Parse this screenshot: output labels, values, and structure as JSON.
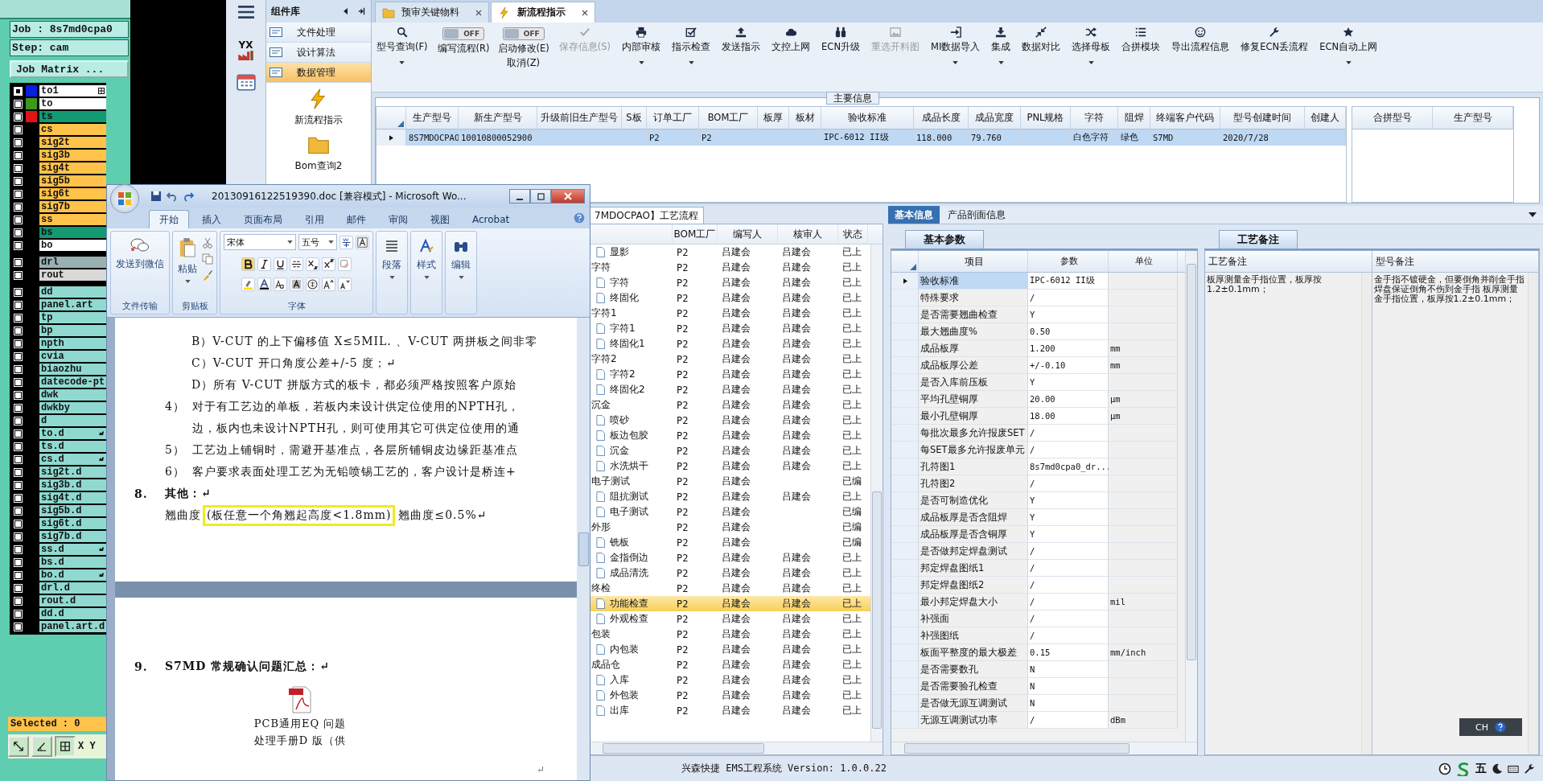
{
  "job_matrix": {
    "job": "Job : 8s7md0cpa0",
    "step": "Step: cam",
    "matrix_button": "Job Matrix ...",
    "layer_groups": [
      [
        {
          "name": "to1",
          "color": "#ffffff",
          "swatch": {
            "color": "#0a1ee0"
          },
          "checked": true,
          "kind": "grid"
        },
        {
          "name": "to",
          "color": "#ffffff",
          "swatch": {
            "color": "#3a9a1e"
          },
          "checked": false,
          "kind": "plain"
        },
        {
          "name": "ts",
          "color": "#129a72",
          "swatch": {
            "color": "#e01414"
          },
          "checked": false,
          "kind": "plain"
        },
        {
          "name": "cs",
          "color": "#ffc24a",
          "checked": false,
          "kind": "plain"
        },
        {
          "name": "sig2t",
          "color": "#ffc24a",
          "checked": false,
          "kind": "plain"
        },
        {
          "name": "sig3b",
          "color": "#ffc24a",
          "checked": false,
          "kind": "plain"
        },
        {
          "name": "sig4t",
          "color": "#ffc24a",
          "checked": false,
          "kind": "plain"
        },
        {
          "name": "sig5b",
          "color": "#ffc24a",
          "checked": false,
          "kind": "plain"
        },
        {
          "name": "sig6t",
          "color": "#ffc24a",
          "checked": false,
          "kind": "plain"
        },
        {
          "name": "sig7b",
          "color": "#ffc24a",
          "checked": false,
          "kind": "plain"
        },
        {
          "name": "ss",
          "color": "#ffc24a",
          "checked": false,
          "kind": "plain"
        },
        {
          "name": "bs",
          "color": "#129a72",
          "checked": false,
          "kind": "plain"
        },
        {
          "name": "bo",
          "color": "#ffffff",
          "checked": false,
          "kind": "plain"
        }
      ],
      [
        {
          "name": "drl",
          "color": "#9ab0b0",
          "checked": false,
          "kind": "plain"
        },
        {
          "name": "rout",
          "color": "#d8d8d8",
          "checked": false,
          "kind": "plain"
        }
      ],
      [
        {
          "name": "dd",
          "color": "#8fd9d0",
          "checked": false,
          "kind": "plain"
        },
        {
          "name": "panel.art",
          "color": "#8fd9d0",
          "checked": false,
          "kind": "plain"
        },
        {
          "name": "tp",
          "color": "#8fd9d0",
          "checked": false,
          "kind": "plain"
        },
        {
          "name": "bp",
          "color": "#8fd9d0",
          "checked": false,
          "kind": "plain"
        },
        {
          "name": "npth",
          "color": "#8fd9d0",
          "checked": false,
          "kind": "plain"
        },
        {
          "name": "cvia",
          "color": "#8fd9d0",
          "checked": false,
          "kind": "plain"
        },
        {
          "name": "biaozhu",
          "color": "#8fd9d0",
          "checked": false,
          "kind": "plain"
        },
        {
          "name": "datecode-pt",
          "color": "#8fd9d0",
          "checked": false,
          "kind": "plain"
        },
        {
          "name": "dwk",
          "color": "#8fd9d0",
          "checked": false,
          "kind": "plain"
        },
        {
          "name": "dwkby",
          "color": "#8fd9d0",
          "checked": false,
          "kind": "plain"
        },
        {
          "name": "d",
          "color": "#8fd9d0",
          "checked": false,
          "kind": "plain"
        },
        {
          "name": "to.d",
          "color": "#8fd9d0",
          "checked": false,
          "kind": "hand"
        },
        {
          "name": "ts.d",
          "color": "#8fd9d0",
          "checked": false,
          "kind": "plain"
        },
        {
          "name": "cs.d",
          "color": "#8fd9d0",
          "checked": false,
          "kind": "hand"
        },
        {
          "name": "sig2t.d",
          "color": "#8fd9d0",
          "checked": false,
          "kind": "plain"
        },
        {
          "name": "sig3b.d",
          "color": "#8fd9d0",
          "checked": false,
          "kind": "plain"
        },
        {
          "name": "sig4t.d",
          "color": "#8fd9d0",
          "checked": false,
          "kind": "plain"
        },
        {
          "name": "sig5b.d",
          "color": "#8fd9d0",
          "checked": false,
          "kind": "plain"
        },
        {
          "name": "sig6t.d",
          "color": "#8fd9d0",
          "checked": false,
          "kind": "plain"
        },
        {
          "name": "sig7b.d",
          "color": "#8fd9d0",
          "checked": false,
          "kind": "plain"
        },
        {
          "name": "ss.d",
          "color": "#8fd9d0",
          "checked": false,
          "kind": "hand"
        },
        {
          "name": "bs.d",
          "color": "#8fd9d0",
          "checked": false,
          "kind": "plain"
        },
        {
          "name": "bo.d",
          "color": "#8fd9d0",
          "checked": false,
          "kind": "hand"
        },
        {
          "name": "drl.d",
          "color": "#8fd9d0",
          "checked": false,
          "kind": "plain"
        },
        {
          "name": "rout.d",
          "color": "#8fd9d0",
          "checked": false,
          "kind": "plain"
        },
        {
          "name": "dd.d",
          "color": "#8fd9d0",
          "checked": false,
          "kind": "plain"
        },
        {
          "name": "panel.art.d",
          "color": "#8fd9d0",
          "checked": false,
          "kind": "plain"
        }
      ]
    ],
    "selected_count": "Selected : 0",
    "coordinate_label": "X Y"
  },
  "app": {
    "strip_icons": [
      {
        "kind": "factory",
        "text": "YX"
      },
      {
        "kind": "calendar"
      }
    ],
    "component_library": {
      "title": "组件库",
      "items": [
        {
          "label": "文件处理",
          "selected": false
        },
        {
          "label": "设计算法",
          "selected": false
        },
        {
          "label": "数据管理",
          "selected": true
        }
      ],
      "tools": [
        "新流程指示",
        "Bom查询2"
      ]
    },
    "tabs": [
      {
        "label": "预审关键物料",
        "selected": false
      },
      {
        "label": "新流程指示",
        "selected": true
      }
    ],
    "toolbar": [
      {
        "kind": "button",
        "label": "型号查询(F)",
        "menu": true,
        "disabled": false
      },
      {
        "kind": "toggle",
        "label": "编写流程(R)",
        "state": "OFF",
        "on": false
      },
      {
        "kind": "toggle",
        "label": "启动修改(E)",
        "sublabel": "取消(Z)",
        "state": "OFF",
        "on": false
      },
      {
        "kind": "button",
        "label": "保存信息(S)",
        "menu": false,
        "disabled": true
      },
      {
        "kind": "button",
        "label": "内部审核",
        "menu": true,
        "disabled": false
      },
      {
        "kind": "button",
        "label": "指示检查",
        "menu": true,
        "disabled": false
      },
      {
        "kind": "button",
        "label": "发送指示",
        "menu": false,
        "disabled": false
      },
      {
        "kind": "button",
        "label": "文控上网",
        "menu": false,
        "disabled": false
      },
      {
        "kind": "button",
        "label": "ECN升级",
        "menu": false,
        "disabled": false
      },
      {
        "kind": "button",
        "label": "重选开料图",
        "menu": false,
        "disabled": true
      },
      {
        "kind": "button",
        "label": "MI数据导入",
        "menu": true,
        "disabled": false
      },
      {
        "kind": "button",
        "label": "集成",
        "menu": true,
        "disabled": false
      },
      {
        "kind": "button",
        "label": "数据对比",
        "menu": false,
        "disabled": false
      },
      {
        "kind": "button",
        "label": "选择母板",
        "menu": true,
        "disabled": false
      },
      {
        "kind": "button",
        "label": "合拼模块",
        "menu": false,
        "disabled": false
      },
      {
        "kind": "button",
        "label": "导出流程信息",
        "menu": false,
        "disabled": false
      },
      {
        "kind": "button",
        "label": "修复ECN丢流程",
        "menu": false,
        "disabled": false
      },
      {
        "kind": "button",
        "label": "ECN自动上网",
        "menu": true,
        "disabled": false
      }
    ],
    "main_info": {
      "title": "主要信息",
      "columns": [
        "生产型号",
        "新生产型号",
        "升级前旧生产型号",
        "S板",
        "订单工厂",
        "BOM工厂",
        "板厚",
        "板材",
        "验收标准",
        "成品长度",
        "成品宽度",
        "PNL规格",
        "字符",
        "阻焊",
        "终端客户代码",
        "型号创建时间",
        "创建人"
      ],
      "rows": [
        {
          "selected": true,
          "cells": [
            "8S7MDOCPAO",
            "10010800052900",
            "",
            "",
            "P2",
            "P2",
            "",
            "",
            "IPC-6012 II级",
            "118.000",
            "79.760",
            "",
            "白色字符",
            "绿色",
            "S7MD",
            "2020/7/28",
            ""
          ]
        }
      ],
      "merge_columns": [
        "合拼型号",
        "生产型号"
      ]
    },
    "process_flow": {
      "tab": "7MDOCPAO】工艺流程",
      "columns": [
        "BOM工厂",
        "编写人",
        "核审人",
        "状态"
      ],
      "rows": [
        {
          "children": [
            {
              "label": "显影",
              "bom": "P2",
              "writer": "吕建会",
              "reviewer": "吕建会",
              "status": "已上",
              "selected": false
            }
          ]
        },
        {
          "label": "字符",
          "bom": "P2",
          "writer": "吕建会",
          "reviewer": "吕建会",
          "status": "已上",
          "selected": false,
          "children": [
            {
              "label": "字符",
              "bom": "P2",
              "writer": "吕建会",
              "reviewer": "吕建会",
              "status": "已上",
              "selected": false
            },
            {
              "label": "终固化",
              "bom": "P2",
              "writer": "吕建会",
              "reviewer": "吕建会",
              "status": "已上",
              "selected": false
            }
          ]
        },
        {
          "label": "字符1",
          "bom": "P2",
          "writer": "吕建会",
          "reviewer": "吕建会",
          "status": "已上",
          "selected": false,
          "children": [
            {
              "label": "字符1",
              "bom": "P2",
              "writer": "吕建会",
              "reviewer": "吕建会",
              "status": "已上",
              "selected": false
            },
            {
              "label": "终固化1",
              "bom": "P2",
              "writer": "吕建会",
              "reviewer": "吕建会",
              "status": "已上",
              "selected": false
            }
          ]
        },
        {
          "label": "字符2",
          "bom": "P2",
          "writer": "吕建会",
          "reviewer": "吕建会",
          "status": "已上",
          "selected": false,
          "children": [
            {
              "label": "字符2",
              "bom": "P2",
              "writer": "吕建会",
              "reviewer": "吕建会",
              "status": "已上",
              "selected": false
            },
            {
              "label": "终固化2",
              "bom": "P2",
              "writer": "吕建会",
              "reviewer": "吕建会",
              "status": "已上",
              "selected": false
            }
          ]
        },
        {
          "label": "沉金",
          "bom": "P2",
          "writer": "吕建会",
          "reviewer": "吕建会",
          "status": "已上",
          "selected": false,
          "children": [
            {
              "label": "喷砂",
              "bom": "P2",
              "writer": "吕建会",
              "reviewer": "吕建会",
              "status": "已上",
              "selected": false
            },
            {
              "label": "板边包胶",
              "bom": "P2",
              "writer": "吕建会",
              "reviewer": "吕建会",
              "status": "已上",
              "selected": false
            },
            {
              "label": "沉金",
              "bom": "P2",
              "writer": "吕建会",
              "reviewer": "吕建会",
              "status": "已上",
              "selected": false
            },
            {
              "label": "水洗烘干",
              "bom": "P2",
              "writer": "吕建会",
              "reviewer": "吕建会",
              "status": "已上",
              "selected": false
            }
          ]
        },
        {
          "label": "电子测试",
          "bom": "P2",
          "writer": "吕建会",
          "status": "已编",
          "selected": false,
          "children": [
            {
              "label": "阻抗测试",
              "bom": "P2",
              "writer": "吕建会",
              "reviewer": "吕建会",
              "status": "已上",
              "selected": false
            },
            {
              "label": "电子测试",
              "bom": "P2",
              "writer": "吕建会",
              "status": "已编",
              "selected": false
            }
          ]
        },
        {
          "label": "外形",
          "bom": "P2",
          "writer": "吕建会",
          "status": "已编",
          "selected": false,
          "children": [
            {
              "label": "铣板",
              "bom": "P2",
              "writer": "吕建会",
              "status": "已编",
              "selected": false
            },
            {
              "label": "金指倒边",
              "bom": "P2",
              "writer": "吕建会",
              "reviewer": "吕建会",
              "status": "已上",
              "selected": false
            },
            {
              "label": "成品清洗",
              "bom": "P2",
              "writer": "吕建会",
              "reviewer": "吕建会",
              "status": "已上",
              "selected": false
            }
          ]
        },
        {
          "label": "终检",
          "bom": "P2",
          "writer": "吕建会",
          "reviewer": "吕建会",
          "status": "已上",
          "selected": false,
          "children": [
            {
              "label": "功能检查",
              "bom": "P2",
              "writer": "吕建会",
              "reviewer": "吕建会",
              "status": "已上",
              "selected": true
            },
            {
              "label": "外观检查",
              "bom": "P2",
              "writer": "吕建会",
              "reviewer": "吕建会",
              "status": "已上",
              "selected": false
            }
          ]
        },
        {
          "label": "包装",
          "bom": "P2",
          "writer": "吕建会",
          "reviewer": "吕建会",
          "status": "已上",
          "selected": false,
          "children": [
            {
              "label": "内包装",
              "bom": "P2",
              "writer": "吕建会",
              "reviewer": "吕建会",
              "status": "已上",
              "selected": false
            }
          ]
        },
        {
          "label": "成品仓",
          "bom": "P2",
          "writer": "吕建会",
          "reviewer": "吕建会",
          "status": "已上",
          "selected": false,
          "children": [
            {
              "label": "入库",
              "bom": "P2",
              "writer": "吕建会",
              "reviewer": "吕建会",
              "status": "已上",
              "selected": false
            },
            {
              "label": "外包装",
              "bom": "P2",
              "writer": "吕建会",
              "reviewer": "吕建会",
              "status": "已上",
              "selected": false
            },
            {
              "label": "出库",
              "bom": "P2",
              "writer": "吕建会",
              "reviewer": "吕建会",
              "status": "已上",
              "selected": false
            }
          ]
        }
      ]
    },
    "basic_info": {
      "tabs": [
        {
          "label": "基本信息",
          "selected": true
        },
        {
          "label": "产品剖面信息",
          "selected": false
        }
      ],
      "params": {
        "tab": "基本参数",
        "columns": [
          "项目",
          "参数",
          "单位"
        ],
        "rows": [
          {
            "item": "验收标准",
            "value": "IPC-6012 II级",
            "selected": true
          },
          {
            "item": "特殊要求",
            "value": "/",
            "selected": false
          },
          {
            "item": "是否需要翘曲检查",
            "value": "Y",
            "selected": false
          },
          {
            "item": "最大翘曲度%",
            "value": "0.50",
            "selected": false
          },
          {
            "item": "成品板厚",
            "value": "1.200",
            "unit": "mm",
            "selected": false
          },
          {
            "item": "成品板厚公差",
            "value": "+/-0.10",
            "unit": "mm",
            "selected": false
          },
          {
            "item": "是否入库前压板",
            "value": "Y",
            "selected": false
          },
          {
            "item": "平均孔壁铜厚",
            "value": "20.00",
            "unit": "μm",
            "selected": false
          },
          {
            "item": "最小孔壁铜厚",
            "value": "18.00",
            "unit": "μm",
            "selected": false
          },
          {
            "item": "每批次最多允许报废SET",
            "value": "/",
            "selected": false
          },
          {
            "item": "每SET最多允许报废单元",
            "value": "/",
            "selected": false
          },
          {
            "item": "孔符图1",
            "value": "8s7md0cpa0_dr...",
            "selected": false
          },
          {
            "item": "孔符图2",
            "value": "/",
            "selected": false
          },
          {
            "item": "是否可制造优化",
            "value": "Y",
            "selected": false
          },
          {
            "item": "成品板厚是否含阻焊",
            "value": "Y",
            "selected": false
          },
          {
            "item": "成品板厚是否含铜厚",
            "value": "Y",
            "selected": false
          },
          {
            "item": "是否做邦定焊盘测试",
            "value": "/",
            "selected": false
          },
          {
            "item": "邦定焊盘图纸1",
            "value": "/",
            "selected": false
          },
          {
            "item": "邦定焊盘图纸2",
            "value": "/",
            "selected": false
          },
          {
            "item": "最小邦定焊盘大小",
            "value": "/",
            "unit": "mil",
            "selected": false
          },
          {
            "item": "补强面",
            "value": "/",
            "selected": false
          },
          {
            "item": "补强图纸",
            "value": "/",
            "selected": false
          },
          {
            "item": "板面平整度的最大极差",
            "value": "0.15",
            "unit": "mm/inch",
            "selected": false
          },
          {
            "item": "是否需要数孔",
            "value": "N",
            "selected": false
          },
          {
            "item": "是否需要验孔检查",
            "value": "N",
            "selected": false
          },
          {
            "item": "是否做无源互调测试",
            "value": "N",
            "selected": false
          },
          {
            "item": "无源互调测试功率",
            "value": "/",
            "unit": "dBm",
            "selected": false
          }
        ]
      },
      "notes": {
        "tab": "工艺备注",
        "columns": [
          "工艺备注",
          "型号备注"
        ],
        "cells": [
          "板厚测量金手指位置，板厚按1.2±0.1mm；",
          "金手指不镀硬金，但要倒角并削金手指焊盘保证倒角不伤到金手指 板厚测量金手指位置，板厚按1.2±0.1mm；"
        ]
      },
      "language_bar": "CH"
    },
    "status_bar": {
      "text": "兴森快捷 EMS工程系统 Version: 1.0.0.22",
      "ime": "五"
    }
  },
  "word_window": {
    "title": "20130916122519390.doc [兼容模式] - Microsoft Wo...",
    "tabs": [
      {
        "label": "开始",
        "selected": true
      },
      {
        "label": "插入",
        "selected": false
      },
      {
        "label": "页面布局",
        "selected": false
      },
      {
        "label": "引用",
        "selected": false
      },
      {
        "label": "邮件",
        "selected": false
      },
      {
        "label": "审阅",
        "selected": false
      },
      {
        "label": "视图",
        "selected": false
      },
      {
        "label": "Acrobat",
        "selected": false
      }
    ],
    "ribbon": {
      "send_button": "发送到微信",
      "send_group": "文件传输",
      "paste_button": "粘贴",
      "clipboard_group": "剪贴板",
      "font": "宋体",
      "font_size": "五号",
      "font_group": "字体",
      "paragraph": "段落",
      "styles": "样式",
      "editing": "编辑"
    },
    "page1": [
      {
        "kind": "sub",
        "text": "B）V-CUT 的上下偏移值 X≤5MIL. 、V-CUT 两拼板之间非零"
      },
      {
        "kind": "sub",
        "text": "C）V-CUT 开口角度公差+/-5 度；↵"
      },
      {
        "kind": "sub",
        "text": "D）所有 V-CUT 拼版方式的板卡，都必须严格按照客户原始"
      },
      {
        "kind": "num",
        "num": "4）",
        "text": "对于有工艺边的单板，若板内未设计供定位使用的NPTH孔，"
      },
      {
        "kind": "cont",
        "text": "边，板内也未设计NPTH孔，则可使用其它可供定位使用的通"
      },
      {
        "kind": "num",
        "num": "5）",
        "text": "工艺边上铺铜时，需避开基准点，各层所铺铜皮边缘距基准点"
      },
      {
        "kind": "num",
        "num": "6）",
        "text": "客户要求表面处理工艺为无铅喷锡工艺的，客户设计是桥连+"
      },
      {
        "kind": "heading",
        "num": "8.",
        "text": "其他：↵"
      },
      {
        "kind": "body",
        "text": "翘曲度",
        "highlight": "(板任意一个角翘起高度<1.8mm)",
        "tail": "翘曲度≤0.5%↵"
      }
    ],
    "page2": {
      "num": "9.",
      "heading": "S7MD 常规确认问题汇总：↵",
      "attachment": [
        "PCB通用EQ 问题",
        "处理手册D 版（供"
      ],
      "end_mark": "↵"
    }
  }
}
